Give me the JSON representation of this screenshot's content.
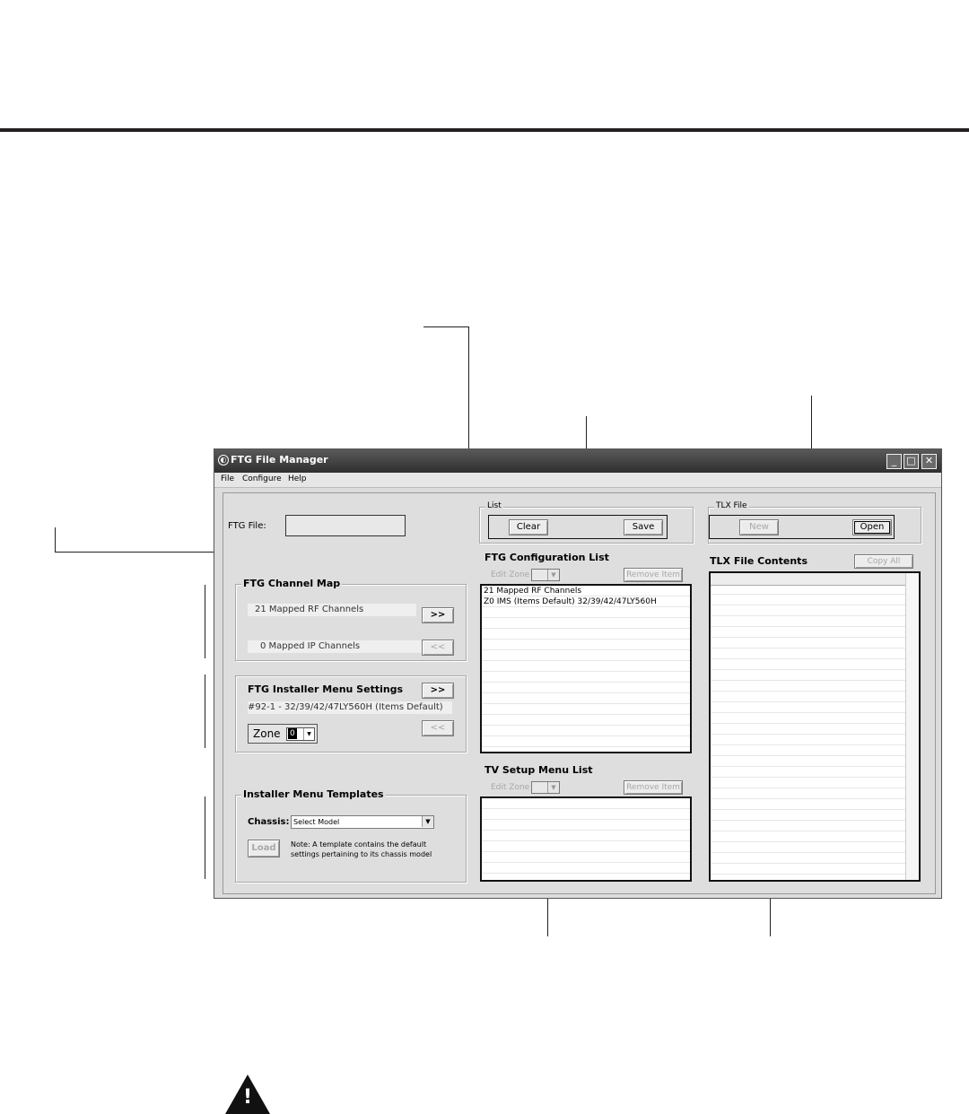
{
  "window": {
    "title": "FTG File Manager"
  },
  "menu": {
    "file": "File",
    "configure": "Configure",
    "help": "Help"
  },
  "ftg_file": {
    "label": "FTG File:",
    "value": ""
  },
  "channel_map": {
    "title": "FTG Channel Map",
    "rf": "21 Mapped RF Channels",
    "ip": "0 Mapped IP Channels",
    "add": ">>",
    "remove": "<<"
  },
  "installer_settings": {
    "title": "FTG Installer Menu Settings",
    "value": "#92-1 - 32/39/42/47LY560H (Items Default)",
    "add": ">>",
    "remove": "<<",
    "zone_label": "Zone",
    "zone_value": "0"
  },
  "templates": {
    "title": "Installer Menu Templates",
    "chassis_label": "Chassis:",
    "chassis_value": "Select Model",
    "load": "Load",
    "note_line1": "Note:  A template contains the default",
    "note_line2": "settings pertaining to its chassis model"
  },
  "list_group": {
    "title": "List",
    "clear": "Clear",
    "save": "Save"
  },
  "tlx_group": {
    "title": "TLX File",
    "new": "New",
    "open": "Open"
  },
  "config_list": {
    "title": "FTG Configuration List",
    "edit_zone": "Edit Zone",
    "remove": "Remove Item",
    "items": [
      "21 Mapped RF Channels",
      "Z0 IMS (Items Default) 32/39/42/47LY560H"
    ]
  },
  "setup_list": {
    "title": "TV Setup Menu List",
    "edit_zone": "Edit Zone",
    "remove": "Remove Item"
  },
  "tlx_contents": {
    "title": "TLX File Contents",
    "copy_all": "Copy All"
  }
}
